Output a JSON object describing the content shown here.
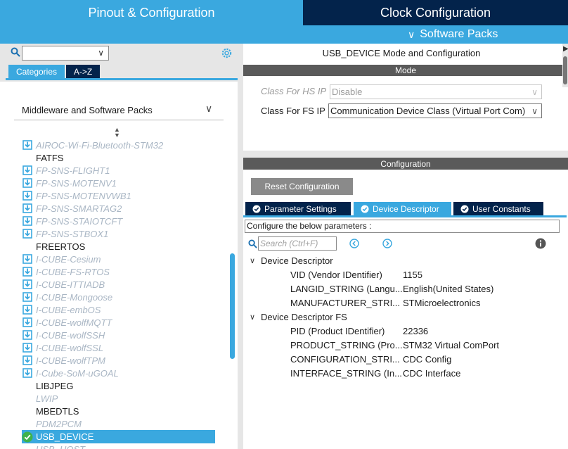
{
  "top_tabs": {
    "pinout": "Pinout & Configuration",
    "clock": "Clock Configuration"
  },
  "software_packs": {
    "label": "Software Packs",
    "chevron": "chevron-down-icon"
  },
  "left": {
    "search": {
      "value": ""
    },
    "tabs": {
      "categories": "Categories",
      "az": "A->Z"
    },
    "section_label": "Middleware and Software Packs",
    "items": [
      {
        "label": "AIROC-Wi-Fi-Bluetooth-STM32",
        "style": "dim"
      },
      {
        "label": "FATFS",
        "style": "plain"
      },
      {
        "label": "FP-SNS-FLIGHT1",
        "style": "dim"
      },
      {
        "label": "FP-SNS-MOTENV1",
        "style": "dim"
      },
      {
        "label": "FP-SNS-MOTENVWB1",
        "style": "dim"
      },
      {
        "label": "FP-SNS-SMARTAG2",
        "style": "dim"
      },
      {
        "label": "FP-SNS-STAIOTCFT",
        "style": "dim"
      },
      {
        "label": "FP-SNS-STBOX1",
        "style": "dim"
      },
      {
        "label": "FREERTOS",
        "style": "plain"
      },
      {
        "label": "I-CUBE-Cesium",
        "style": "dim"
      },
      {
        "label": "I-CUBE-FS-RTOS",
        "style": "dim"
      },
      {
        "label": "I-CUBE-ITTIADB",
        "style": "dim"
      },
      {
        "label": "I-CUBE-Mongoose",
        "style": "dim"
      },
      {
        "label": "I-CUBE-embOS",
        "style": "dim"
      },
      {
        "label": "I-CUBE-wolfMQTT",
        "style": "dim"
      },
      {
        "label": "I-CUBE-wolfSSH",
        "style": "dim"
      },
      {
        "label": "I-CUBE-wolfSSL",
        "style": "dim"
      },
      {
        "label": "I-CUBE-wolfTPM",
        "style": "dim"
      },
      {
        "label": "I-Cube-SoM-uGOAL",
        "style": "dim"
      },
      {
        "label": "LIBJPEG",
        "style": "plain"
      },
      {
        "label": "LWIP",
        "style": "dimplain"
      },
      {
        "label": "MBEDTLS",
        "style": "plain"
      },
      {
        "label": "PDM2PCM",
        "style": "dimplain"
      },
      {
        "label": "USB_DEVICE",
        "style": "selected"
      },
      {
        "label": "USB_HOST",
        "style": "dimplain"
      }
    ]
  },
  "right": {
    "mode_title": "USB_DEVICE Mode and Configuration",
    "mode_header": "Mode",
    "hs": {
      "label": "Class For HS IP",
      "value": "Disable"
    },
    "fs": {
      "label": "Class For FS IP",
      "value": "Communication Device Class (Virtual Port Com)"
    },
    "config_header": "Configuration",
    "reset_label": "Reset Configuration",
    "tabs": [
      "Parameter Settings",
      "Device Descriptor",
      "User Constants"
    ],
    "params_hint": "Configure the below parameters :",
    "search_placeholder": "Search (Ctrl+F)",
    "groups": [
      {
        "title": "Device Descriptor",
        "rows": [
          {
            "name": "VID (Vendor IDentifier)",
            "value": "1155"
          },
          {
            "name": "LANGID_STRING (Langu...",
            "value": "English(United States)"
          },
          {
            "name": "MANUFACTURER_STRI...",
            "value": "STMicroelectronics"
          }
        ]
      },
      {
        "title": "Device Descriptor FS",
        "rows": [
          {
            "name": "PID (Product IDentifier)",
            "value": "22336"
          },
          {
            "name": "PRODUCT_STRING (Pro...",
            "value": "STM32 Virtual ComPort"
          },
          {
            "name": "CONFIGURATION_STRI...",
            "value": "CDC Config"
          },
          {
            "name": "INTERFACE_STRING (In...",
            "value": "CDC Interface"
          }
        ]
      }
    ]
  },
  "colors": {
    "accent": "#3aa8df",
    "navy": "#03234b",
    "header_gray": "#5a5a5a",
    "selected_check": "#3fb24c"
  }
}
